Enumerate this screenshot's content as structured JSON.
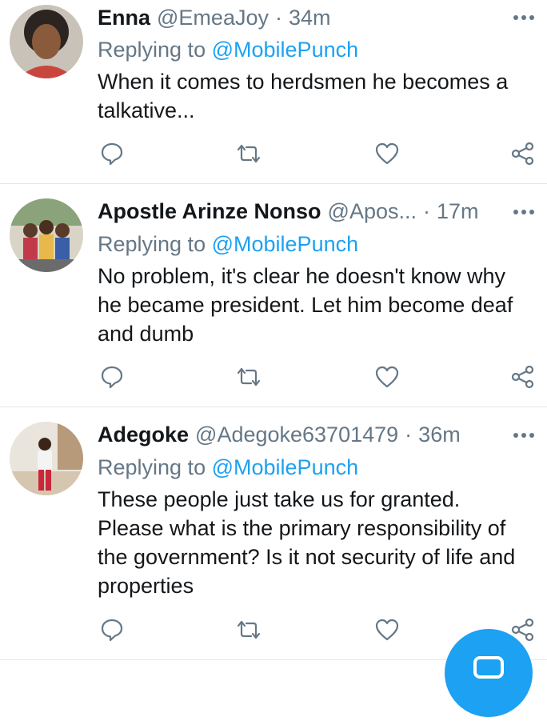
{
  "tweets": [
    {
      "name": "Enna",
      "handle": "@EmeaJoy",
      "separator": "·",
      "time": "34m",
      "replying_prefix": "Replying to",
      "replying_to": "@MobilePunch",
      "lines": [
        "When it comes to herdsmen he becomes a",
        "talkative..."
      ]
    },
    {
      "name": "Apostle Arinze Nonso",
      "handle": "@Apos...",
      "separator": "·",
      "time": "17m",
      "replying_prefix": "Replying to",
      "replying_to": "@MobilePunch",
      "lines": [
        "No problem, it's clear he doesn't know why",
        "he became president. Let him become deaf",
        "and dumb"
      ]
    },
    {
      "name": "Adegoke",
      "handle": "@Adegoke63701479",
      "separator": "·",
      "time": "36m",
      "replying_prefix": "Replying to",
      "replying_to": "@MobilePunch",
      "lines": [
        "These people just take us for granted.",
        "Please what is the primary responsibility of",
        "the government? Is it not security of life and",
        "properties"
      ]
    }
  ],
  "icons": {
    "more": "more-dots-icon",
    "reply": "reply-bubble-icon",
    "retweet": "retweet-icon",
    "like": "heart-icon",
    "share": "share-icon"
  },
  "colors": {
    "accent": "#1da1f2",
    "secondary_text": "#657786",
    "icon": "#657786",
    "divider": "#e1e8ed"
  }
}
